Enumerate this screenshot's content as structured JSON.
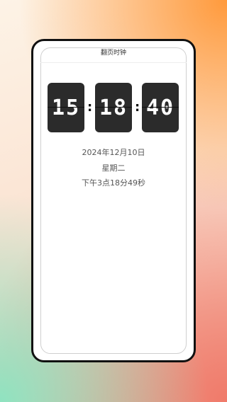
{
  "app": {
    "title": "翻页时钟"
  },
  "clock": {
    "hours": "15",
    "minutes": "18",
    "seconds": "40",
    "separator": ":"
  },
  "info": {
    "date": "2024年12月10日",
    "weekday": "星期二",
    "time_text": "下午3点18分49秒"
  }
}
